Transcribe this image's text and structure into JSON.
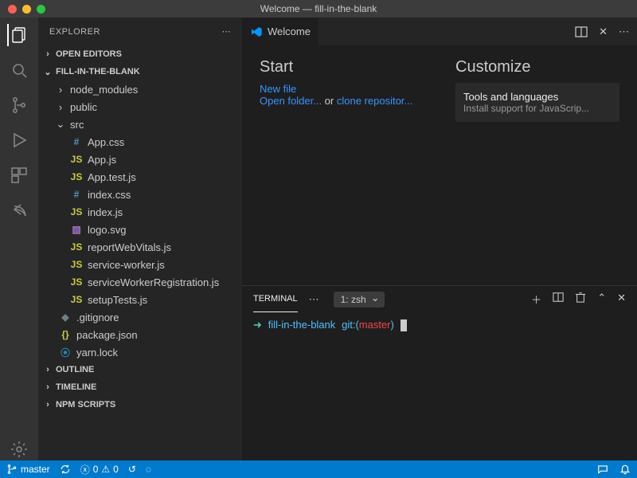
{
  "window": {
    "title": "Welcome — fill-in-the-blank"
  },
  "sidebar": {
    "header": "EXPLORER",
    "sections": {
      "open_editors": "OPEN EDITORS",
      "project": "FILL-IN-THE-BLANK",
      "outline": "OUTLINE",
      "timeline": "TIMELINE",
      "npm": "NPM SCRIPTS"
    },
    "folders": {
      "node_modules": "node_modules",
      "public": "public",
      "src": "src"
    },
    "files": {
      "app_css": "App.css",
      "app_js": "App.js",
      "app_test": "App.test.js",
      "index_css": "index.css",
      "index_js": "index.js",
      "logo": "logo.svg",
      "rwv": "reportWebVitals.js",
      "sw": "service-worker.js",
      "swr": "serviceWorkerRegistration.js",
      "setup": "setupTests.js",
      "gitignore": ".gitignore",
      "pkg": "package.json",
      "yarn": "yarn.lock"
    }
  },
  "tabs": {
    "welcome": "Welcome"
  },
  "welcome": {
    "start_heading": "Start",
    "new_file": "New file",
    "open_folder": "Open folder...",
    "or": " or ",
    "clone": "clone repositor...",
    "customize_heading": "Customize",
    "card_title": "Tools and languages",
    "card_sub": "Install support for JavaScrip..."
  },
  "panel": {
    "terminal_tab": "TERMINAL",
    "shell": "1: zsh"
  },
  "terminal": {
    "arrow": "➜",
    "dir": "fill-in-the-blank",
    "git_label": "git:(",
    "branch": "master",
    "git_close": ")"
  },
  "status": {
    "branch": "master",
    "errors": "0",
    "warnings": "0"
  }
}
